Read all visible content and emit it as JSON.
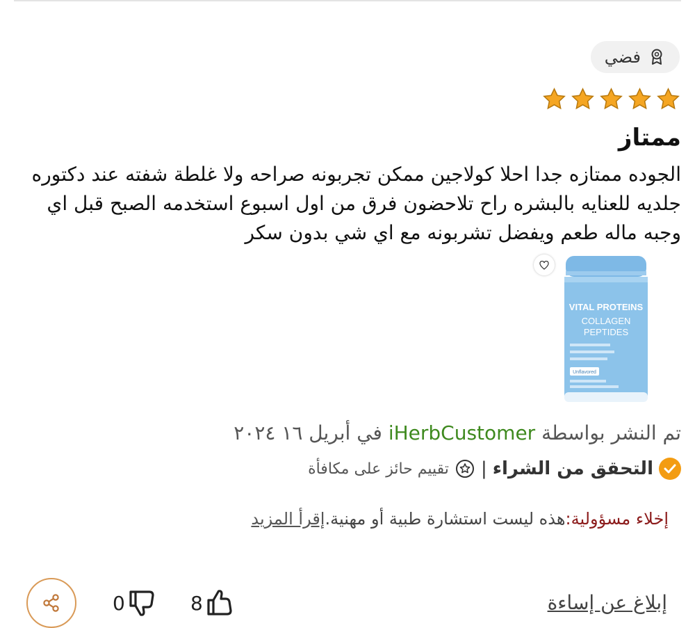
{
  "review": {
    "badge_label": "فضي",
    "badge_icon": "ribbon-icon",
    "rating": 5,
    "title": "ممتاز",
    "body": "الجوده ممتازه جدا احلا كولاجين ممكن تجربونه صراحه ولا غلطة شفته عند دكتوره جلديه للعنايه بالبشره راح تلاحضون فرق من اول اسبوع استخدمه الصبح قبل اي وجبه ماله طعم ويفضل تشربونه مع اي شي بدون سكر",
    "product_image": {
      "brand": "VITAL PROTEINS",
      "line1": "COLLAGEN",
      "line2": "PEPTIDES",
      "flavor": "Unflavored"
    },
    "posted_prefix": "تم النشر بواسطة",
    "author": "iHerbCustomer",
    "posted_date": "في أبريل ١٦ ٢٠٢٤",
    "verified_label": "التحقق من الشراء",
    "separator": "|",
    "reward_label": "تقييم حائز على مكافأة",
    "disclaimer_label": "إخلاء مسؤولية:",
    "disclaimer_text": "هذه ليست استشارة طبية أو مهنية.",
    "read_more": "إقرأ المزيد",
    "dislikes": "0",
    "likes": "8",
    "report_label": "إبلاغ عن إساءة"
  },
  "colors": {
    "star": "#f5a623",
    "author_link": "#3f8a1f",
    "verified_badge": "#f39c12",
    "disclaimer_label": "#8b1a1a",
    "share_border": "#d99a57",
    "product_blue": "#8cc3ea"
  }
}
